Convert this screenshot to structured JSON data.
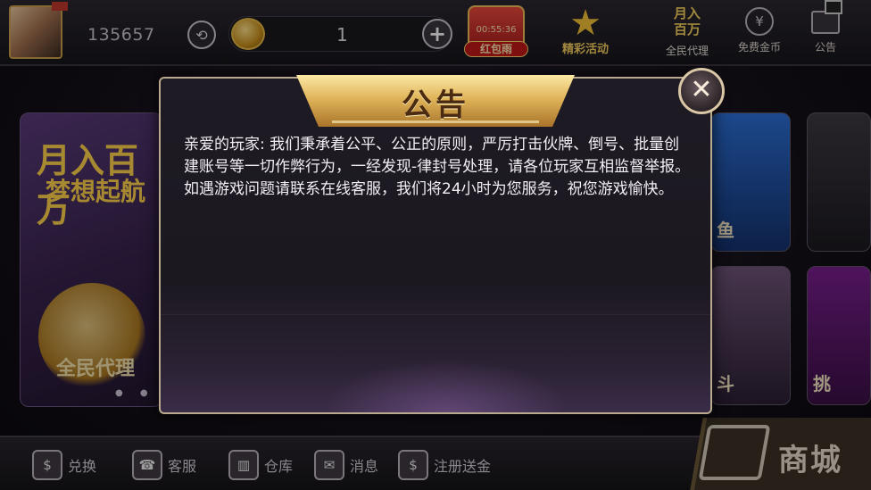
{
  "topbar": {
    "user_id": "135657",
    "coins": "1",
    "plus_label": "+",
    "red_packet": {
      "timer": "00:55:36",
      "label": "红包雨"
    },
    "event": {
      "label": "精彩活动"
    },
    "agent": {
      "headline_1": "月入",
      "headline_2": "百万",
      "label": "全民代理"
    },
    "free_coins": {
      "label": "免费金币",
      "icon": "¥"
    },
    "notice": {
      "label": "公告"
    }
  },
  "lobby": {
    "promo": {
      "line1": "月入百万",
      "line2": "梦想起航",
      "line3": "全民代理"
    },
    "games": [
      {
        "label": "鱼"
      },
      {
        "label": ""
      },
      {
        "label": "斗"
      },
      {
        "label": "挑"
      }
    ]
  },
  "bottombar": {
    "items": [
      {
        "label": "兑换",
        "icon": "$"
      },
      {
        "label": "客服",
        "icon": "☎"
      },
      {
        "label": "仓库",
        "icon": "▥"
      },
      {
        "label": "消息",
        "icon": "✉"
      },
      {
        "label": "注册送金",
        "icon": "$"
      }
    ],
    "shop_label": "商城"
  },
  "modal": {
    "title": "公告",
    "close_glyph": "✕",
    "body": "亲爱的玩家: 我们秉承着公平、公正的原则，严厉打击伙牌、倒号、批量创建账号等一切作弊行为，一经发现-律封号处理，请各位玩家互相监督举报。如遇游戏问题请联系在线客服，我们将24小时为您服务，祝您游戏愉快。"
  }
}
